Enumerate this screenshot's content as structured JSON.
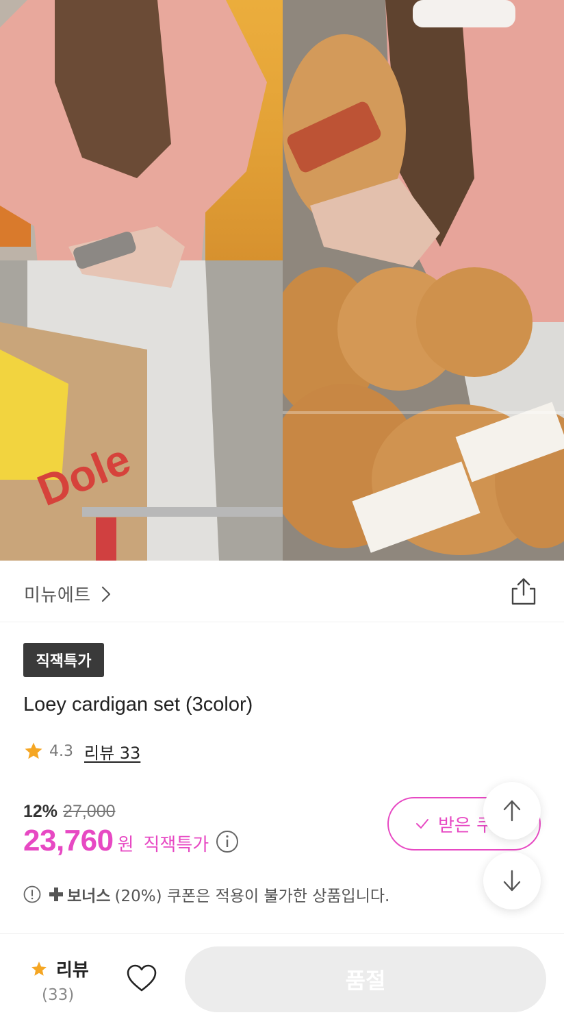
{
  "brand": {
    "name": "미뉴에트"
  },
  "product": {
    "badge": "직잭특가",
    "title": "Loey cardigan set (3color)",
    "rating": "4.3",
    "review_link": "리뷰 33"
  },
  "price": {
    "discount": "12%",
    "original": "27,000",
    "sale": "23,760",
    "unit": "원",
    "tag": "직잭특가"
  },
  "coupon": {
    "label": "받은 쿠"
  },
  "notice": {
    "bold": "보너스",
    "text": "(20%) 쿠폰은 적용이 불가한 상품입니다."
  },
  "bottom_bar": {
    "review_label": "리뷰",
    "review_count": "(33)",
    "soldout_label": "품절"
  },
  "colors": {
    "accent": "#e749c3",
    "star": "#f5a623",
    "badge_bg": "#3a3a3a",
    "disabled": "#ececec"
  },
  "icons": [
    "chevron-right-icon",
    "share-icon",
    "star-icon",
    "info-icon",
    "check-icon",
    "arrow-up-icon",
    "arrow-down-icon",
    "alert-icon",
    "plus-icon",
    "heart-icon"
  ]
}
